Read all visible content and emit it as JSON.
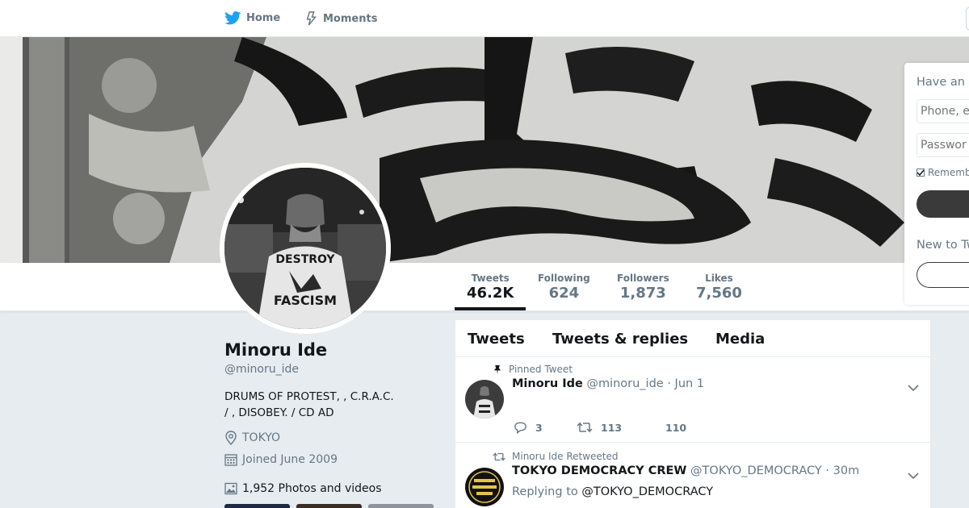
{
  "nav": {
    "home_label": "Home",
    "moments_label": "Moments"
  },
  "profile": {
    "name": "Minoru Ide",
    "handle": "@minoru_ide",
    "bio_line1": "DRUMS OF PROTEST, , C.R.A.C.",
    "bio_line2": "/ , DISOBEY.  / CD AD",
    "location": "TOKYO",
    "joined": "Joined June 2009",
    "photos": "1,952 Photos and videos"
  },
  "stats": [
    {
      "label": "Tweets",
      "value": "46.2K",
      "active": true
    },
    {
      "label": "Following",
      "value": "624"
    },
    {
      "label": "Followers",
      "value": "1,873"
    },
    {
      "label": "Likes",
      "value": "7,560"
    }
  ],
  "tabs": {
    "tweets": "Tweets",
    "replies": "Tweets & replies",
    "media": "Media"
  },
  "tweets": [
    {
      "context": "Pinned Tweet",
      "name": "Minoru Ide",
      "handle": "@minoru_ide",
      "sep": "·",
      "time": "Jun 1",
      "replies": "3",
      "retweets": "113",
      "likes": "110"
    },
    {
      "context": "Minoru Ide Retweeted",
      "name": "TOKYO DEMOCRACY CREW",
      "handle": "@TOKYO_DEMOCRACY",
      "sep": "·",
      "time": "30m",
      "replying_prefix": "Replying to",
      "replying_to": "@TOKYO_DEMOCRACY"
    }
  ],
  "login": {
    "title": "Have an a",
    "phone_placeholder": "Phone, e",
    "password_placeholder": "Passwor",
    "remember": "Rememb",
    "new_to": "New to Tw"
  },
  "colors": {
    "accent": "#1da1f2",
    "text": "#14171a",
    "muted": "#657786",
    "background": "#e6ecf0"
  }
}
